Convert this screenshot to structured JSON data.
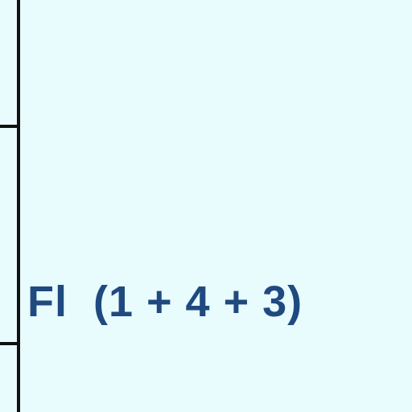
{
  "colors": {
    "background": "#e8fbfd",
    "line": "#111111",
    "text": "#1f4a7f"
  },
  "label": {
    "text": "Fl  (1 + 4 + 3)"
  }
}
